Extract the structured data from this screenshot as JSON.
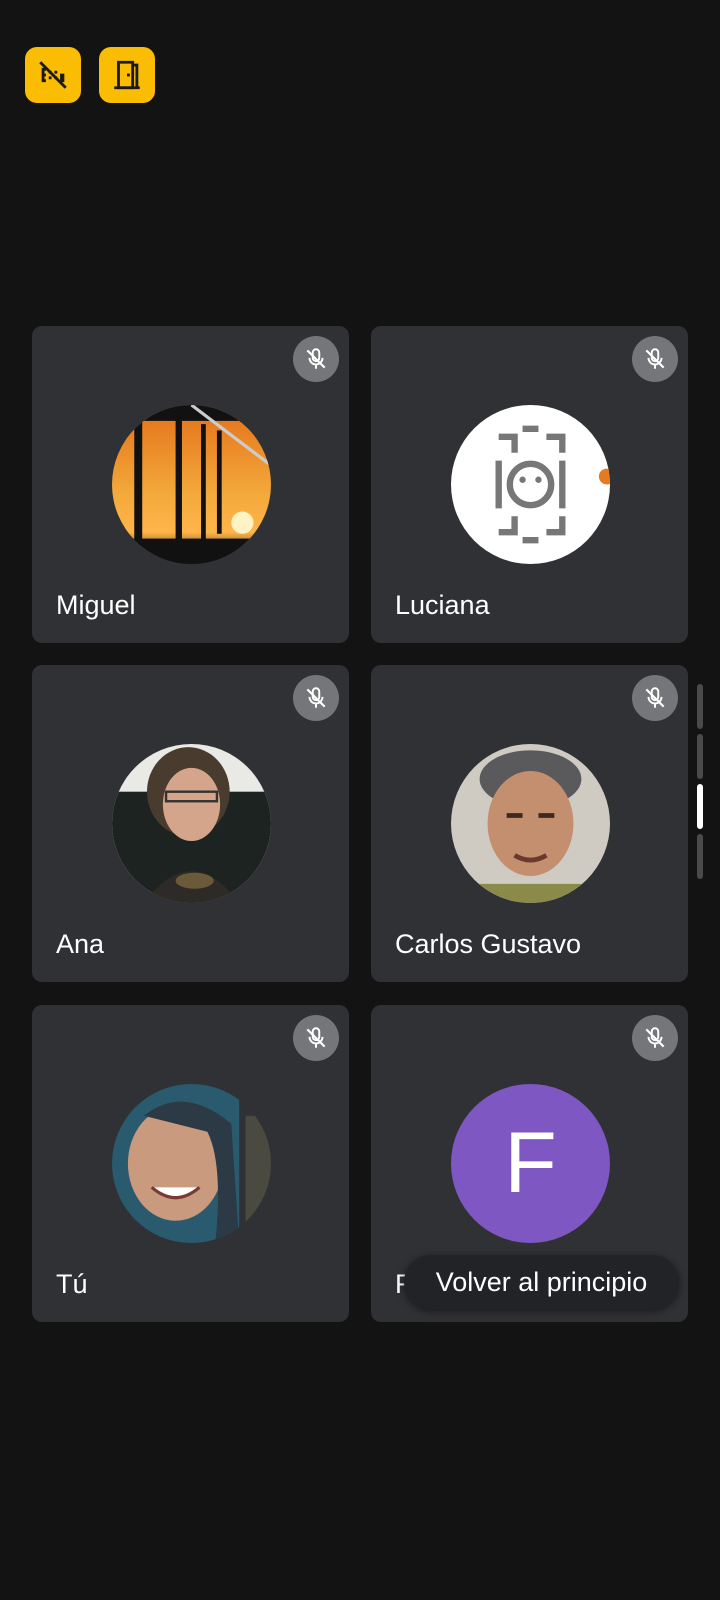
{
  "participants": [
    {
      "name": "Miguel",
      "muted": true,
      "avatar": "sunset-photo"
    },
    {
      "name": "Luciana",
      "muted": true,
      "avatar": "tribal-art-logo"
    },
    {
      "name": "Ana",
      "muted": true,
      "avatar": "woman-portrait-photo"
    },
    {
      "name": "Carlos Gustavo",
      "muted": true,
      "avatar": "man-portrait-photo"
    },
    {
      "name": "Tú",
      "muted": true,
      "avatar": "self-portrait-photo"
    },
    {
      "name": "Fu",
      "muted": true,
      "avatar": "letter",
      "initial": "F"
    }
  ],
  "toast": {
    "label": "Volver al principio"
  },
  "top_controls": [
    "camera-off-icon",
    "exit-door-icon"
  ],
  "colors": {
    "background": "#131313",
    "tile": "#303134",
    "accent": "#fbbc04",
    "mic_badge": "#757679",
    "letter_avatar": "#7e57c2"
  }
}
